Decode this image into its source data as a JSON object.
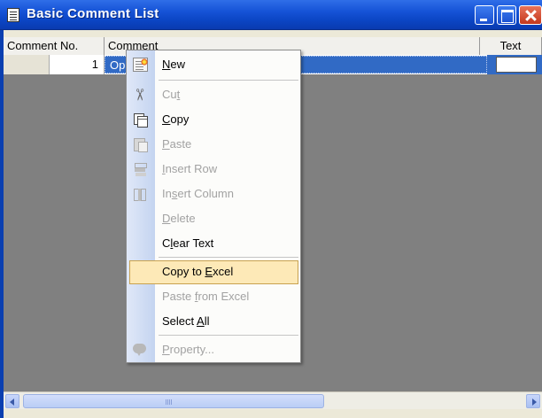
{
  "window": {
    "title": "Basic Comment List"
  },
  "grid": {
    "columns": [
      "Comment No.",
      "Comment",
      "Text"
    ],
    "rows": [
      {
        "no": "1",
        "comment": "Op"
      }
    ]
  },
  "context_menu": {
    "items": [
      {
        "label_pre": "",
        "label_ul": "N",
        "label_post": "ew",
        "enabled": true
      },
      {
        "label_pre": "Cu",
        "label_ul": "t",
        "label_post": "",
        "enabled": false
      },
      {
        "label_pre": "",
        "label_ul": "C",
        "label_post": "opy",
        "enabled": true
      },
      {
        "label_pre": "",
        "label_ul": "P",
        "label_post": "aste",
        "enabled": false
      },
      {
        "label_pre": "",
        "label_ul": "I",
        "label_post": "nsert Row",
        "enabled": false
      },
      {
        "label_pre": "In",
        "label_ul": "s",
        "label_post": "ert Column",
        "enabled": false
      },
      {
        "label_pre": "",
        "label_ul": "D",
        "label_post": "elete",
        "enabled": false
      },
      {
        "label_pre": "C",
        "label_ul": "l",
        "label_post": "ear Text",
        "enabled": true
      },
      {
        "label_pre": "Copy to ",
        "label_ul": "E",
        "label_post": "xcel",
        "enabled": true,
        "highlighted": true
      },
      {
        "label_pre": "Paste ",
        "label_ul": "f",
        "label_post": "rom Excel",
        "enabled": false
      },
      {
        "label_pre": "Select ",
        "label_ul": "A",
        "label_post": "ll",
        "enabled": true
      },
      {
        "label_pre": "",
        "label_ul": "P",
        "label_post": "roperty...",
        "enabled": false
      }
    ],
    "icons": [
      "new-icon",
      "cut-icon",
      "copy-icon",
      "paste-icon",
      "insert-row-icon",
      "insert-column-icon",
      "property-icon"
    ],
    "colors": {
      "highlight_fill": "#fde9b7",
      "highlight_border": "#c8a250",
      "disabled_text": "#a2a2a2"
    }
  },
  "colors": {
    "titlebar": "#0b45c4",
    "selection": "#316ac5",
    "grid_empty": "#808080"
  }
}
